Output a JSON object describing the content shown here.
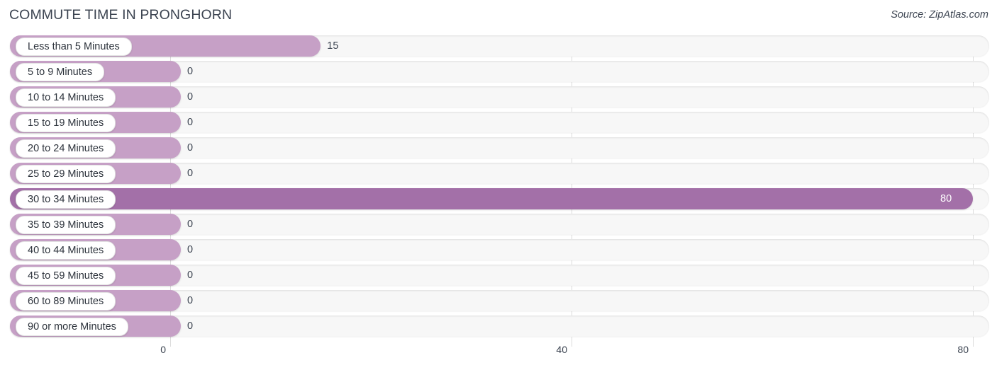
{
  "header": {
    "title": "COMMUTE TIME IN PRONGHORN",
    "source": "Source: ZipAtlas.com"
  },
  "colors": {
    "bar_default": "#c6a0c6",
    "bar_highlight": "#a370a8",
    "track": "#f7f7f7",
    "gridline": "#dcdcdc",
    "text": "#3c4451",
    "value_inside": "#ffffff"
  },
  "chart_data": {
    "type": "bar",
    "orientation": "horizontal",
    "title": "COMMUTE TIME IN PRONGHORN",
    "xlabel": "",
    "ylabel": "",
    "xlim": [
      0,
      80
    ],
    "xticks": [
      0,
      40,
      80
    ],
    "xtick_labels": [
      "0",
      "40",
      "80"
    ],
    "grid": true,
    "legend": false,
    "categories": [
      "Less than 5 Minutes",
      "5 to 9 Minutes",
      "10 to 14 Minutes",
      "15 to 19 Minutes",
      "20 to 24 Minutes",
      "25 to 29 Minutes",
      "30 to 34 Minutes",
      "35 to 39 Minutes",
      "40 to 44 Minutes",
      "45 to 59 Minutes",
      "60 to 89 Minutes",
      "90 or more Minutes"
    ],
    "values": [
      15,
      0,
      0,
      0,
      0,
      0,
      80,
      0,
      0,
      0,
      0,
      0
    ],
    "value_labels": [
      "15",
      "0",
      "0",
      "0",
      "0",
      "0",
      "80",
      "0",
      "0",
      "0",
      "0",
      "0"
    ],
    "highlight_index": 6
  },
  "rows": [
    {
      "label": "Less than 5 Minutes",
      "value": 15,
      "value_label": "15",
      "highlight": false
    },
    {
      "label": "5 to 9 Minutes",
      "value": 0,
      "value_label": "0",
      "highlight": false
    },
    {
      "label": "10 to 14 Minutes",
      "value": 0,
      "value_label": "0",
      "highlight": false
    },
    {
      "label": "15 to 19 Minutes",
      "value": 0,
      "value_label": "0",
      "highlight": false
    },
    {
      "label": "20 to 24 Minutes",
      "value": 0,
      "value_label": "0",
      "highlight": false
    },
    {
      "label": "25 to 29 Minutes",
      "value": 0,
      "value_label": "0",
      "highlight": false
    },
    {
      "label": "30 to 34 Minutes",
      "value": 80,
      "value_label": "80",
      "highlight": true
    },
    {
      "label": "35 to 39 Minutes",
      "value": 0,
      "value_label": "0",
      "highlight": false
    },
    {
      "label": "40 to 44 Minutes",
      "value": 0,
      "value_label": "0",
      "highlight": false
    },
    {
      "label": "45 to 59 Minutes",
      "value": 0,
      "value_label": "0",
      "highlight": false
    },
    {
      "label": "60 to 89 Minutes",
      "value": 0,
      "value_label": "0",
      "highlight": false
    },
    {
      "label": "90 or more Minutes",
      "value": 0,
      "value_label": "0",
      "highlight": false
    }
  ],
  "axis": {
    "ticks": [
      {
        "label": "0",
        "value": 0
      },
      {
        "label": "40",
        "value": 40
      },
      {
        "label": "80",
        "value": 80
      }
    ]
  }
}
